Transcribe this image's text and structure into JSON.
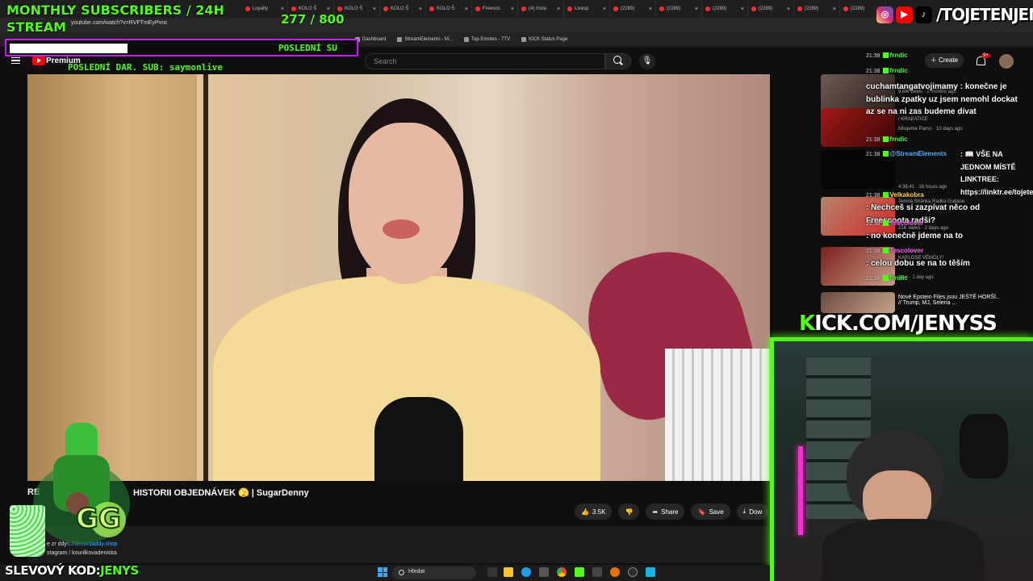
{
  "browser": {
    "tabs": [
      {
        "label": "Loyalty"
      },
      {
        "label": "KOLO Š"
      },
      {
        "label": "KOLO Š"
      },
      {
        "label": "KOLO Š"
      },
      {
        "label": "KOLO Š"
      },
      {
        "label": "Freesco"
      },
      {
        "label": "(4) Insta"
      },
      {
        "label": "Livesp"
      },
      {
        "label": "(2289)"
      },
      {
        "label": "(2289)"
      },
      {
        "label": "(2289)"
      },
      {
        "label": "(2289)"
      },
      {
        "label": "(2289)"
      },
      {
        "label": "(2289)"
      }
    ],
    "url": "youtube.com/watch?v=RVFTmEyPvnc",
    "bookmarks": [
      "Dashboard",
      "StreamElements - M...",
      "Top Emotes - 7TV",
      "KICK Status Page"
    ]
  },
  "youtube": {
    "premium_label": "Premium",
    "search_placeholder": "Search",
    "create_label": "Create",
    "notif_badge": "9+",
    "video_title_left": "RE",
    "video_title_right": "HISTORII OBJEDNÁVEK 🫣 | SugarDenny",
    "actions": {
      "likes": "3.5K",
      "share": "Share",
      "save": "Save",
      "download": "Dow"
    },
    "description_lines": [
      {
        "prefix": "e zr",
        "mid": "ddy",
        "link": "s://decordaddy.shop"
      },
      {
        "prefix": "stagram",
        "mid": "",
        "link": "/ kourilkovadeniska"
      }
    ]
  },
  "sidebar_videos": [
    {
      "title": "",
      "meta": "9.6M views · 2 months ago"
    },
    {
      "title": "/ KRAKATICE",
      "meta": "Milujeme Parno · 10 days ago"
    },
    {
      "title": "",
      "meta": "4:38:41 · 16 hours ago"
    },
    {
      "title": "Temná Stránka Radka Gudase.",
      "meta": "21K views · 2 days ago"
    },
    {
      "title": "KARLOSE VÉMOLY!",
      "meta": "New · 1 day ago"
    },
    {
      "title": "Nové Epstein Files jsou JEŠTĚ HORŠÍ.. // Trump, MJ, Selena ...",
      "meta": ""
    }
  ],
  "chat": [
    {
      "time": "21:38",
      "user": "frndic",
      "text": ""
    },
    {
      "time": "21:38",
      "user": "frndic",
      "text": "cuchamtangatvojimamy : konečne je bublinka zpatky uz jsem nemohl dockat az se na ni zas budeme divat"
    },
    {
      "time": "21:38",
      "user": "frndic",
      "text": ""
    },
    {
      "time": "21:38",
      "user": "@StreamElements",
      "text": ": 📖 VŠE NA JEDNOM MÍSTĚ LINKTREE: https://linktr.ee/tojetenjenys"
    },
    {
      "time": "21:38",
      "user": "Velkakobra",
      "text": ": Nechceš si zazpívat něco od Freescoota radši?"
    },
    {
      "time": "21:38",
      "user": "Tescolover",
      "text": ": no konečně jdeme na to"
    },
    {
      "time": "21:38",
      "user": "Tescolover",
      "text": ": celou dobu se na to těším"
    },
    {
      "time": "21:38",
      "user": "frndic",
      "text": ""
    }
  ],
  "overlays": {
    "subs_title_1": "MONTHLY SUBSCRIBERS / 24H",
    "subs_title_2": "STREAM",
    "subs_count": "277 / 800",
    "donation_scroll": "POSLEDNÍ SU",
    "last_sub": "POSLEDNÍ DAR. SUB: saymonlive",
    "social_handle": "/TOJETENJENYS",
    "kick_first": "K",
    "kick_rest": "ICK.COM/JENYSS",
    "promo_label": "SLEVOVÝ KOD:",
    "promo_code": "JENYS"
  },
  "taskbar": {
    "search_label": "Hledat"
  },
  "colors": {
    "kick_green": "#53fc18",
    "yt_red": "#ff0000",
    "donation_border": "#c61fff"
  }
}
